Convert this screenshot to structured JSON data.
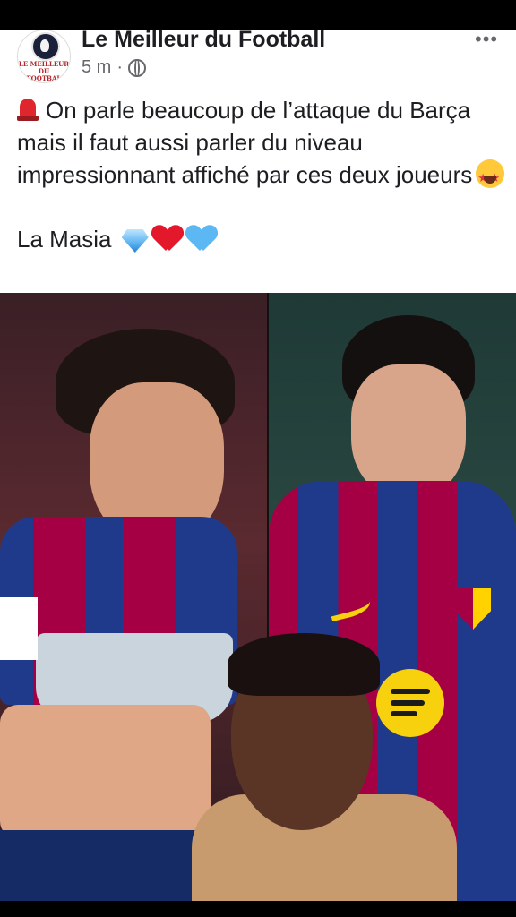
{
  "post": {
    "page_name": "Le Meilleur du Football",
    "timestamp": "5 m",
    "separator": "·",
    "more_label": "•••",
    "avatar_text": "LE MEILLEUR DU FOOTBALL",
    "text_line1": "On parle beaucoup de l’attaque du Barça mais il faut aussi parler du niveau impressionnant affiché par ces deux joueurs",
    "text_line2": "La Masia"
  },
  "colors": {
    "text": "#1c1e21",
    "meta": "#65676b",
    "barca_blue": "#1f3a8a",
    "barca_red": "#a50044",
    "spotify_yellow": "#f7d10d"
  },
  "icons": [
    "siren-emoji",
    "star-struck-emoji",
    "gem-emoji",
    "red-heart-emoji",
    "blue-heart-emoji",
    "globe-icon",
    "more-icon"
  ]
}
